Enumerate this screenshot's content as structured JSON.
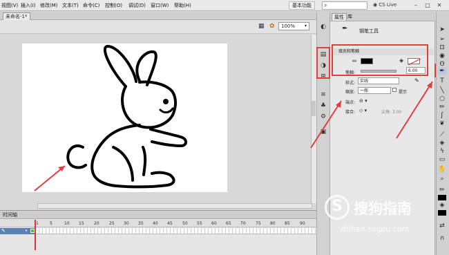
{
  "menu": {
    "items": [
      "视图(V)",
      "插入(I)",
      "修改(M)",
      "文本(T)",
      "命令(C)",
      "控制(O)",
      "调试(D)",
      "窗口(W)",
      "帮助(H)"
    ],
    "workspace": "基本功能",
    "cs_live": "CS Live"
  },
  "document": {
    "tab": "未命名-1*"
  },
  "stage": {
    "zoom": "100%"
  },
  "timeline": {
    "title": "时间轴",
    "frame_numbers": [
      "1",
      "5",
      "10",
      "15",
      "20",
      "25",
      "30",
      "35",
      "40",
      "45",
      "50",
      "55",
      "60",
      "65",
      "70",
      "75",
      "80",
      "85",
      "90"
    ]
  },
  "properties": {
    "tabs": [
      "属性",
      "库"
    ],
    "tool_name": "钢笔工具",
    "fill_stroke_header": "填充和笔触",
    "stroke_label": "笔触:",
    "stroke_value": "6.00",
    "style_label": "样式:",
    "style_value": "实线",
    "scale_label": "缩放:",
    "scale_value": "一般",
    "hint_label": "提示",
    "cap_label": "端点:",
    "join_label": "接合:",
    "miter_label": "尖角: 3.00"
  },
  "colors": {
    "highlight": "#e23c3c",
    "stroke": "#000000",
    "fill": "#000000"
  },
  "watermark": {
    "brand": "搜狗指南",
    "url": "zhinan.sogou.com"
  },
  "icons": [
    "search-icon",
    "pen-tool-icon",
    "selection-tool-icon",
    "subselection-tool-icon",
    "free-transform-icon",
    "lasso-icon",
    "line-tool-icon",
    "oval-tool-icon",
    "pencil-icon",
    "brush-icon",
    "deco-icon",
    "bone-icon",
    "paint-bucket-icon",
    "eyedropper-icon",
    "eraser-icon",
    "hand-icon",
    "zoom-icon"
  ]
}
